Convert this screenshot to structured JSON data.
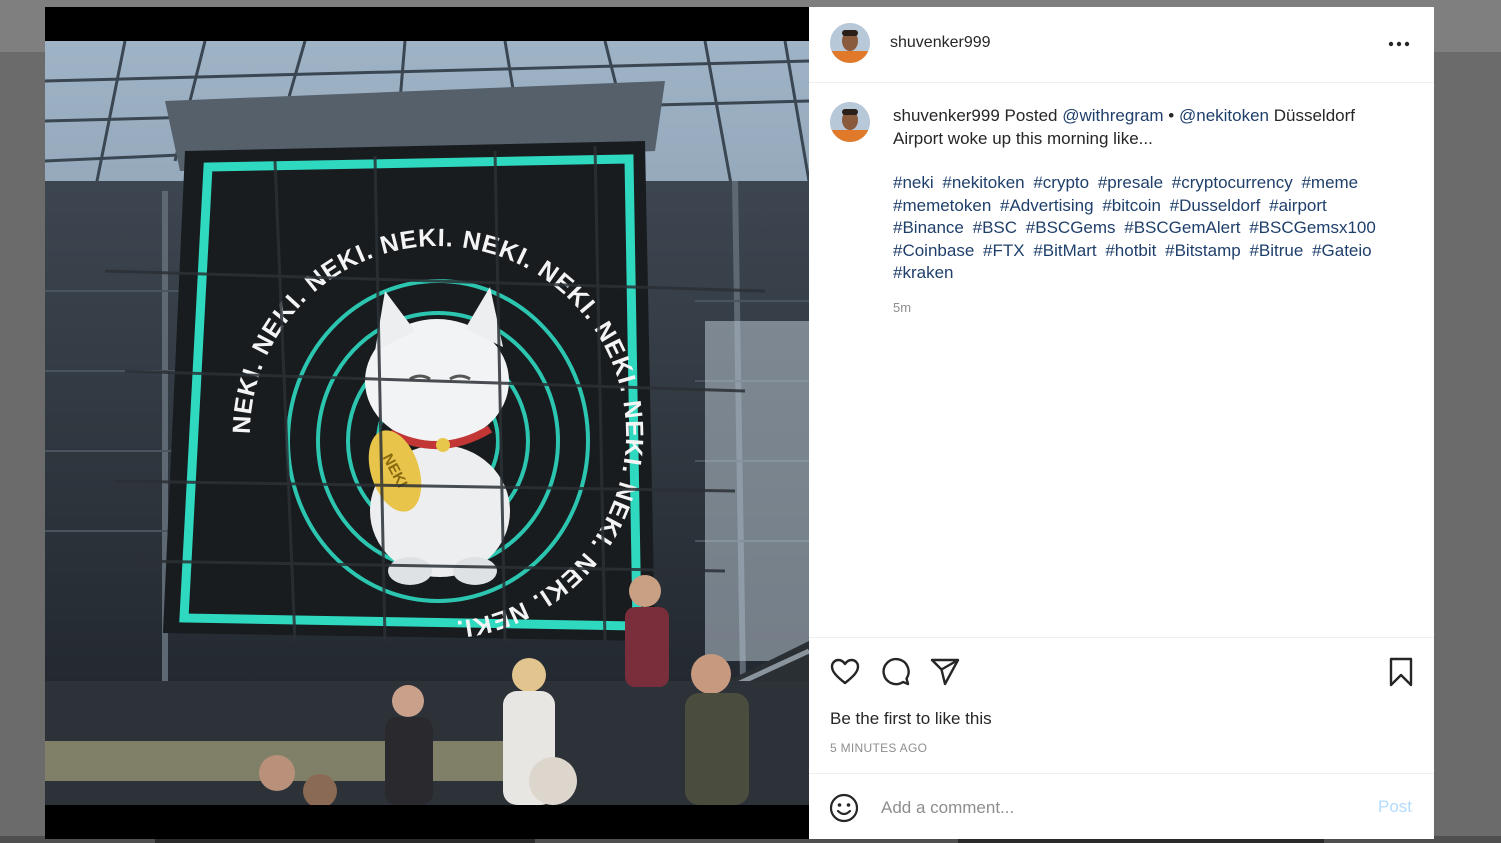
{
  "post": {
    "username": "shuvenker999",
    "caption": {
      "username": "shuvenker999",
      "posted_label": "Posted",
      "mention_1": "@withregram",
      "separator": "•",
      "mention_2": "@nekitoken",
      "text": "Düsseldorf Airport woke up this morning like...",
      "hashtags": [
        "#neki",
        "#nekitoken",
        "#crypto",
        "#presale",
        "#cryptocurrency",
        "#meme",
        "#memetoken",
        "#Advertising",
        "#bitcoin",
        "#Dusseldorf",
        "#airport",
        "#Binance",
        "#BSC",
        "#BSCGems",
        "#BSCGemAlert",
        "#BSCGemsx100",
        "#Coinbase",
        "#FTX",
        "#BitMart",
        "#hotbit",
        "#Bitstamp",
        "#Bitrue",
        "#Gateio",
        "#kraken"
      ],
      "age": "5m"
    },
    "image": {
      "sign_text": "NEKI. NEKI. NEKI. NEKI. NEKI. NEKI. NEKI. NEKI. NEKI. NEKI. NEKI.",
      "coin_text": "NEKI"
    },
    "likes": {
      "prefix": "Be the first to",
      "action": "like this"
    },
    "timestamp": "5 MINUTES AGO",
    "comment": {
      "placeholder": "Add a comment...",
      "post_label": "Post"
    },
    "icons": {
      "more": "more-options-icon",
      "like": "heart-icon",
      "comment": "comment-icon",
      "share": "share-icon",
      "save": "bookmark-icon",
      "emoji": "emoji-icon"
    },
    "colors": {
      "link": "#1f3f6b",
      "post_button": "#b3dbff",
      "sign_accent": "#2fd9c0"
    }
  }
}
